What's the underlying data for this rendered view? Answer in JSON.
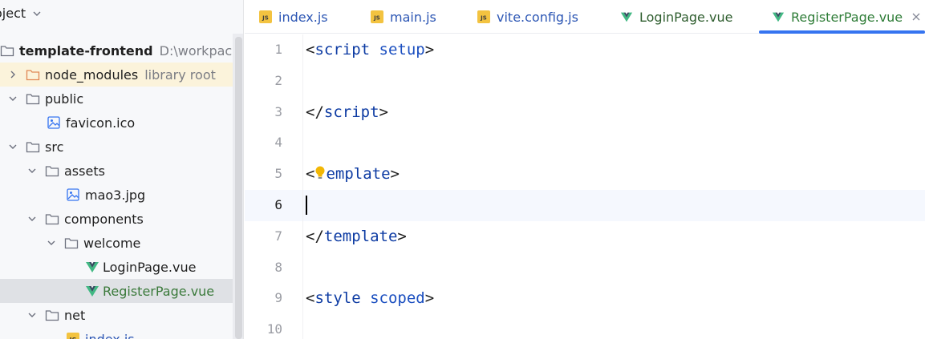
{
  "project_panel": {
    "title": "oject",
    "tree": [
      {
        "name": "template-frontend",
        "hint": "D:\\workpace\\",
        "icon": "folder-icon",
        "expanded": true
      },
      {
        "name": "node_modules",
        "hint": "library root",
        "icon": "folder-excluded-icon",
        "expanded": false
      },
      {
        "name": "public",
        "icon": "folder-icon",
        "expanded": true
      },
      {
        "name": "favicon.ico",
        "icon": "image-file-icon"
      },
      {
        "name": "src",
        "icon": "folder-icon",
        "expanded": true
      },
      {
        "name": "assets",
        "icon": "folder-icon",
        "expanded": true
      },
      {
        "name": "mao3.jpg",
        "icon": "image-file-icon"
      },
      {
        "name": "components",
        "icon": "folder-icon",
        "expanded": true
      },
      {
        "name": "welcome",
        "icon": "folder-icon",
        "expanded": true
      },
      {
        "name": "LoginPage.vue",
        "icon": "vue-file-icon"
      },
      {
        "name": "RegisterPage.vue",
        "icon": "vue-file-icon",
        "selected": true
      },
      {
        "name": "net",
        "icon": "folder-icon",
        "expanded": true
      },
      {
        "name": "index.js",
        "icon": "js-file-icon"
      }
    ]
  },
  "tabs": [
    {
      "label": "index.js",
      "icon": "js-file-icon"
    },
    {
      "label": "main.js",
      "icon": "js-file-icon"
    },
    {
      "label": "vite.config.js",
      "icon": "js-file-icon"
    },
    {
      "label": "LoginPage.vue",
      "icon": "vue-file-icon"
    },
    {
      "label": "RegisterPage.vue",
      "icon": "vue-file-icon",
      "active": true
    }
  ],
  "editor": {
    "line_numbers": [
      "1",
      "2",
      "3",
      "4",
      "5",
      "6",
      "7",
      "8",
      "9",
      "10"
    ],
    "current_line": "6",
    "lines": {
      "l1_open": "<",
      "l1_tag": "script",
      "l1_attr": "setup",
      "l1_close": ">",
      "l3_open": "</",
      "l3_tag": "script",
      "l3_close": ">",
      "l5_open": "<",
      "l5_tag": "emplate",
      "l5_close": ">",
      "l7_open": "</",
      "l7_tag": "template",
      "l7_close": ">",
      "l9_open": "<",
      "l9_tag": "style",
      "l9_attr": "scoped",
      "l9_close": ">"
    }
  },
  "colors": {
    "accent": "#3574f0",
    "tag": "#0d3ba3",
    "vue_green": "#41b883",
    "js_badge": "#f3c340",
    "library_highlight": "#fbf3db",
    "selection": "#dfe1e5"
  }
}
